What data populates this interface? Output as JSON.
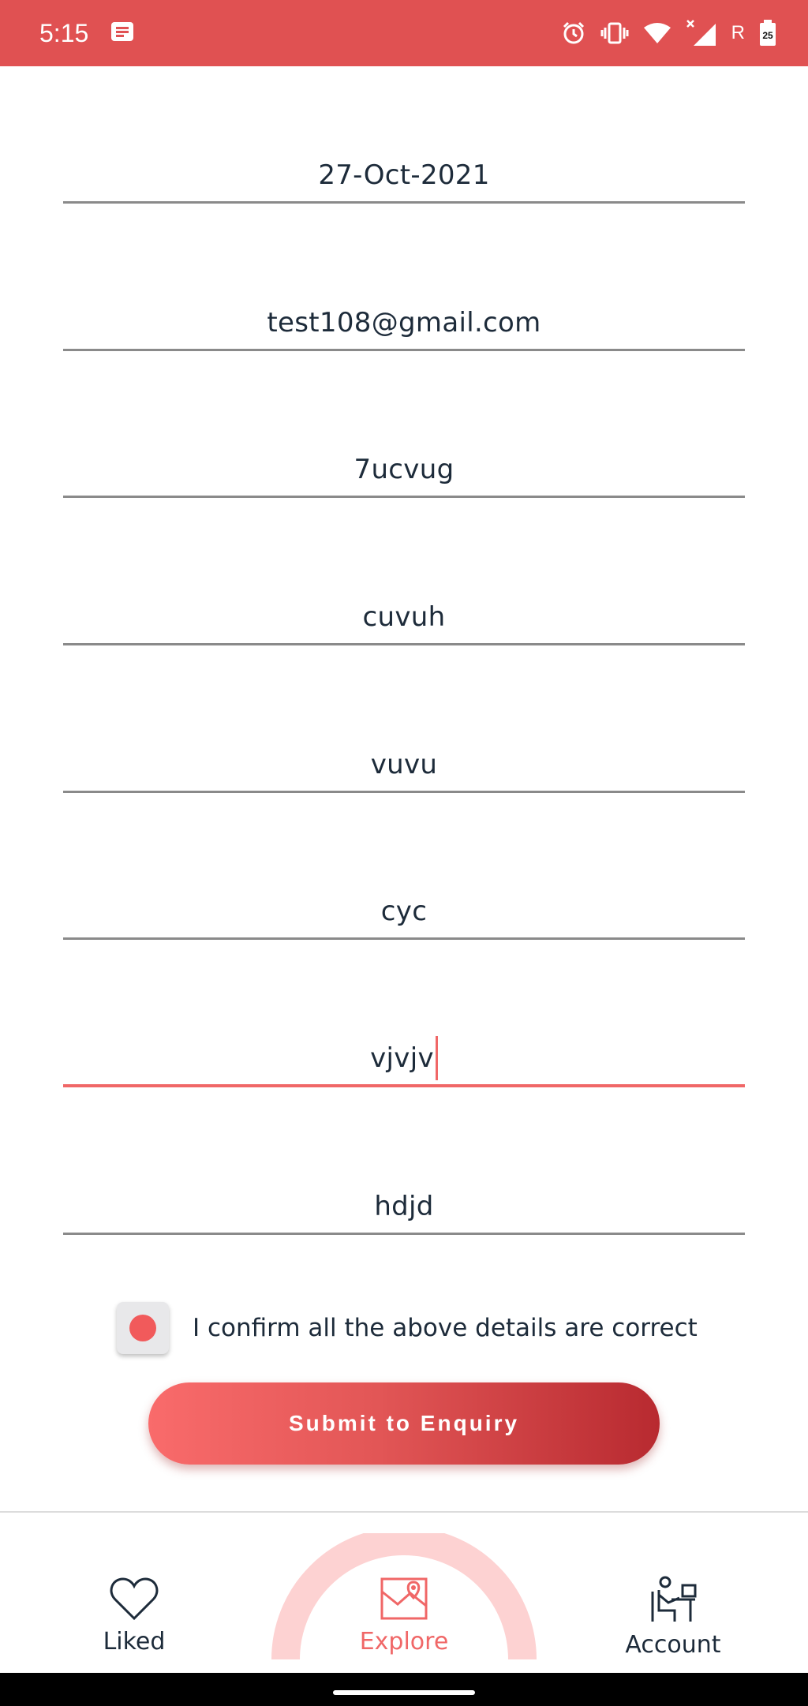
{
  "status_bar": {
    "time": "5:15",
    "carrier_indicator": "R",
    "battery_level": "25",
    "background": "#e05152",
    "icons": [
      "message-icon",
      "alarm-icon",
      "vibrate-icon",
      "wifi-icon",
      "signal-icon",
      "battery-icon"
    ]
  },
  "form": {
    "fields": [
      {
        "value": "27-Oct-2021"
      },
      {
        "value": "test108@gmail.com"
      },
      {
        "value": "7ucvug"
      },
      {
        "value": "cuvuh"
      },
      {
        "value": "vuvu"
      },
      {
        "value": "cyc"
      },
      {
        "value": "vjvjv",
        "focused": true
      },
      {
        "value": "hdjd"
      }
    ],
    "confirm_label": "I confirm all the above details are correct",
    "confirm_checked": true,
    "submit_label": "Submit to Enquiry"
  },
  "bottom_nav": {
    "items": [
      {
        "label": "Liked",
        "icon": "heart-icon"
      },
      {
        "label": "Explore",
        "icon": "map-icon",
        "active": true
      },
      {
        "label": "Account",
        "icon": "person-at-desk-icon"
      }
    ]
  },
  "colors": {
    "accent": "#f06767",
    "text": "#1d2b3a",
    "button_gradient_start": "#f96b6b",
    "button_gradient_end": "#b82a30"
  }
}
